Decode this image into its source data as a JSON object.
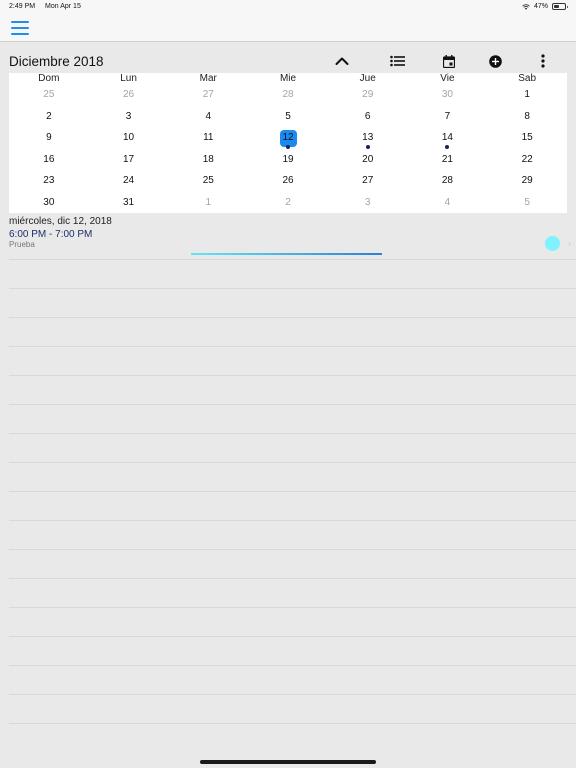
{
  "status_bar": {
    "time": "2:49 PM",
    "date": "Mon Apr 15",
    "battery": "47%",
    "battery_level": 0.47,
    "wifi_icon": "wifi-icon",
    "battery_icon": "battery-icon"
  },
  "nav": {
    "menu_icon": "hamburger-menu-icon"
  },
  "calendar": {
    "month_title": "Diciembre 2018",
    "toolbar_icons": [
      "chevron-up-icon",
      "list-icon",
      "calendar-icon",
      "add-circle-icon",
      "more-vertical-icon"
    ],
    "weekdays": [
      "Dom",
      "Lun",
      "Mar",
      "Mie",
      "Jue",
      "Vie",
      "Sab"
    ],
    "weeks": [
      [
        "25",
        "26",
        "27",
        "28",
        "29",
        "30",
        "1"
      ],
      [
        "2",
        "3",
        "4",
        "5",
        "6",
        "7",
        "8"
      ],
      [
        "9",
        "10",
        "11",
        "12",
        "13",
        "14",
        "15"
      ],
      [
        "16",
        "17",
        "18",
        "19",
        "20",
        "21",
        "22"
      ],
      [
        "23",
        "24",
        "25",
        "26",
        "27",
        "28",
        "29"
      ],
      [
        "30",
        "31",
        "1",
        "2",
        "3",
        "4",
        "5"
      ]
    ],
    "today": "12",
    "event_days": [
      "12",
      "13",
      "14"
    ],
    "accent_color": "#1a8af0",
    "dot_color": "#17235a"
  },
  "agenda": {
    "date_heading": "miércoles, dic 12, 2018",
    "event": {
      "time": "6:00 PM - 7:00 PM",
      "title": "Prueba",
      "color": "#7ff2ff",
      "chevron": "›"
    }
  }
}
